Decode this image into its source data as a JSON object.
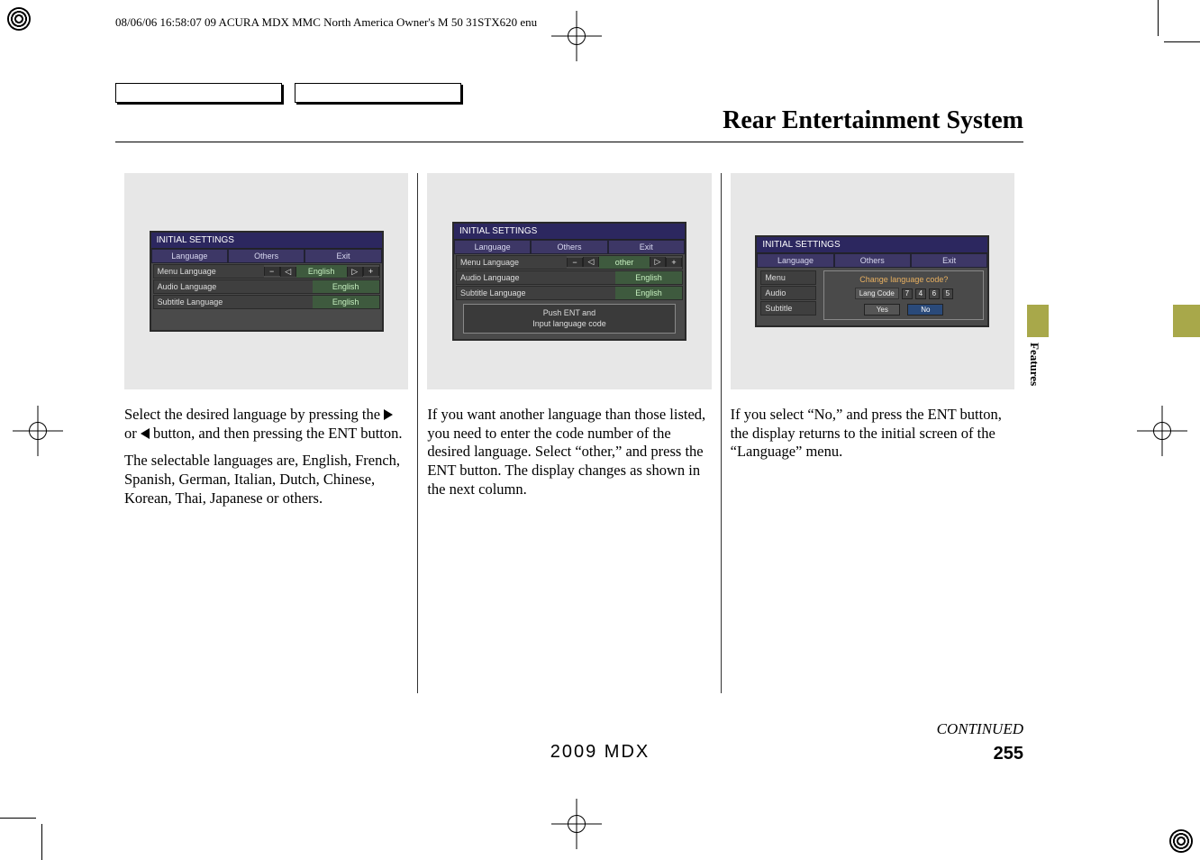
{
  "header_meta": "08/06/06 16:58:07  09 ACURA MDX MMC North America Owner's M 50 31STX620 enu",
  "section_title": "Rear Entertainment System",
  "side_tab_label": "Features",
  "col1": {
    "gui_title": "INITIAL SETTINGS",
    "tabs": {
      "language": "Language",
      "others": "Others",
      "exit": "Exit"
    },
    "rows": {
      "menu": {
        "label": "Menu Language",
        "value": "English"
      },
      "audio": {
        "label": "Audio Language",
        "value": "English"
      },
      "subtitle": {
        "label": "Subtitle Language",
        "value": "English"
      }
    },
    "p1_a": "Select the desired language by pressing the ",
    "p1_b": " or ",
    "p1_c": " button, and then pressing the ENT button.",
    "p2": "The selectable languages are, English, French, Spanish, German, Italian, Dutch, Chinese, Korean, Thai, Japanese or others."
  },
  "col2": {
    "gui_title": "INITIAL SETTINGS",
    "tabs": {
      "language": "Language",
      "others": "Others",
      "exit": "Exit"
    },
    "rows": {
      "menu": {
        "label": "Menu Language",
        "value": "other"
      },
      "audio": {
        "label": "Audio Language",
        "value": "English"
      },
      "subtitle": {
        "label": "Subtitle Language",
        "value": "English"
      }
    },
    "prompt_l1": "Push ENT and",
    "prompt_l2": "Input  language code",
    "p1": "If you want another language than those listed, you need to enter the code number of the desired language. Select “other,” and press the ENT button. The display changes as shown in the next column."
  },
  "col3": {
    "gui_title": "INITIAL SETTINGS",
    "tabs": {
      "language": "Language",
      "others": "Others",
      "exit": "Exit"
    },
    "stubs": {
      "menu": "Menu",
      "audio": "Audio",
      "subtitle": "Subtitle"
    },
    "dialog": {
      "question": "Change language code?",
      "lang_code_label": "Lang Code",
      "digits": [
        "7",
        "4",
        "6",
        "5"
      ],
      "yes": "Yes",
      "no": "No"
    },
    "p1": "If you select “No,” and press the ENT button, the display returns to the initial screen of the “Language” menu."
  },
  "continued": "CONTINUED",
  "footer_model": "2009 MDX",
  "page_no": "255"
}
